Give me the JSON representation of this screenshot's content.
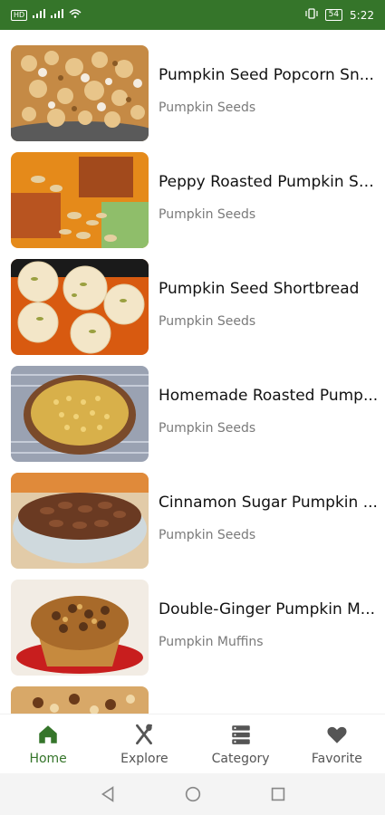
{
  "status_bar": {
    "left_badge": "HD",
    "time": "5:22",
    "battery": "54"
  },
  "items": [
    {
      "title": "Pumpkin Seed Popcorn Sn...",
      "category": "Pumpkin Seeds"
    },
    {
      "title": "Peppy Roasted Pumpkin Se...",
      "category": "Pumpkin Seeds"
    },
    {
      "title": "Pumpkin Seed Shortbread",
      "category": "Pumpkin Seeds"
    },
    {
      "title": "Homemade Roasted Pump...",
      "category": "Pumpkin Seeds"
    },
    {
      "title": "Cinnamon Sugar Pumpkin ...",
      "category": "Pumpkin Seeds"
    },
    {
      "title": "Double-Ginger Pumpkin M...",
      "category": "Pumpkin Muffins"
    }
  ],
  "nav": {
    "home": "Home",
    "explore": "Explore",
    "category": "Category",
    "favorite": "Favorite"
  },
  "colors": {
    "brand": "#35752a",
    "title": "#111111",
    "subtitle": "#7a7a7a"
  }
}
